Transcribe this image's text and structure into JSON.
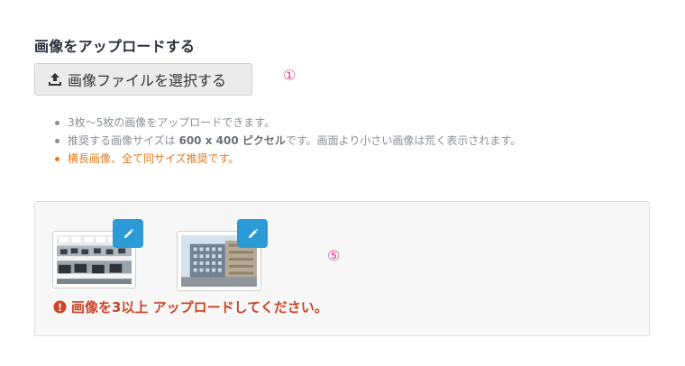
{
  "section": {
    "title": "画像をアップロードする"
  },
  "upload": {
    "button_label": "画像ファイルを選択する",
    "icon": "upload-icon"
  },
  "markers": {
    "first": "①",
    "fifth": "⑤"
  },
  "notes": {
    "item1": "3枚〜5枚の画像をアップロードできます。",
    "item2_before": "推奨する画像サイズは ",
    "item2_bold": "600 x 400 ピクセル",
    "item2_after": "です。画面より小さい画像は荒く表示されます。",
    "item3": "横長画像、全て同サイズ推奨です。"
  },
  "gallery": {
    "images": [
      {
        "description": "office-interior-photo",
        "edit_icon": "pencil-icon"
      },
      {
        "description": "office-building-photo",
        "edit_icon": "pencil-icon"
      }
    ]
  },
  "error": {
    "message": "画像を3以上 アップロードしてください。",
    "icon": "exclamation-circle-icon"
  },
  "colors": {
    "edit_button": "#2b9bd7",
    "error_text": "#c9452a",
    "accent_note": "#e07b1f",
    "marker": "#e0479b"
  }
}
